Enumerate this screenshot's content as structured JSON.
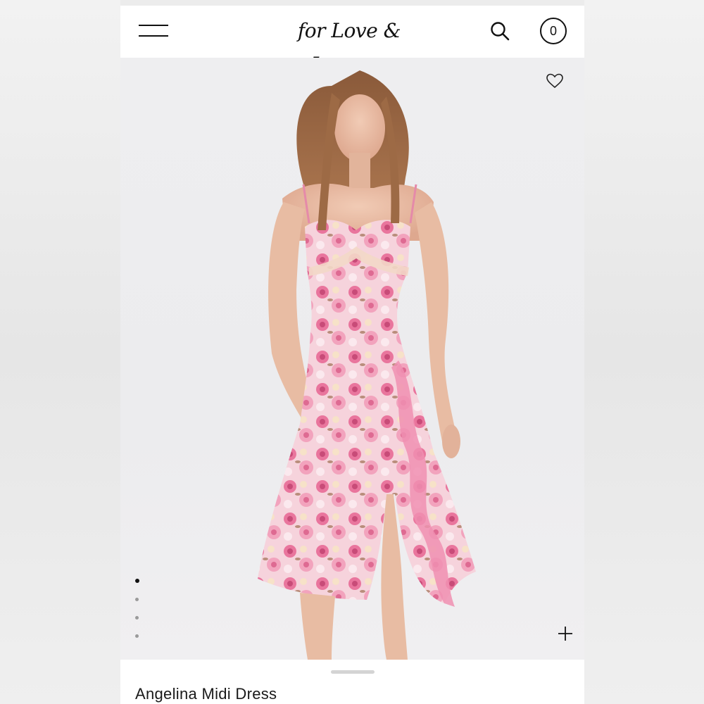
{
  "header": {
    "logo_text": "for Love & Lemons",
    "cart_count": "0",
    "icons": {
      "menu": "hamburger-menu-icon",
      "search": "search-icon",
      "cart": "cart-icon"
    }
  },
  "gallery": {
    "image_count": 4,
    "active_index": 0,
    "wishlist_icon": "heart-outline-icon",
    "zoom_icon": "plus-icon",
    "image_alt": "Model wearing pink floral midi dress with ruffle slit"
  },
  "product": {
    "name": "Angelina Midi Dress"
  },
  "colors": {
    "background": "#ececec",
    "header_bg": "#ffffff",
    "text": "#111111",
    "dress_pink": "#e87aa2"
  }
}
